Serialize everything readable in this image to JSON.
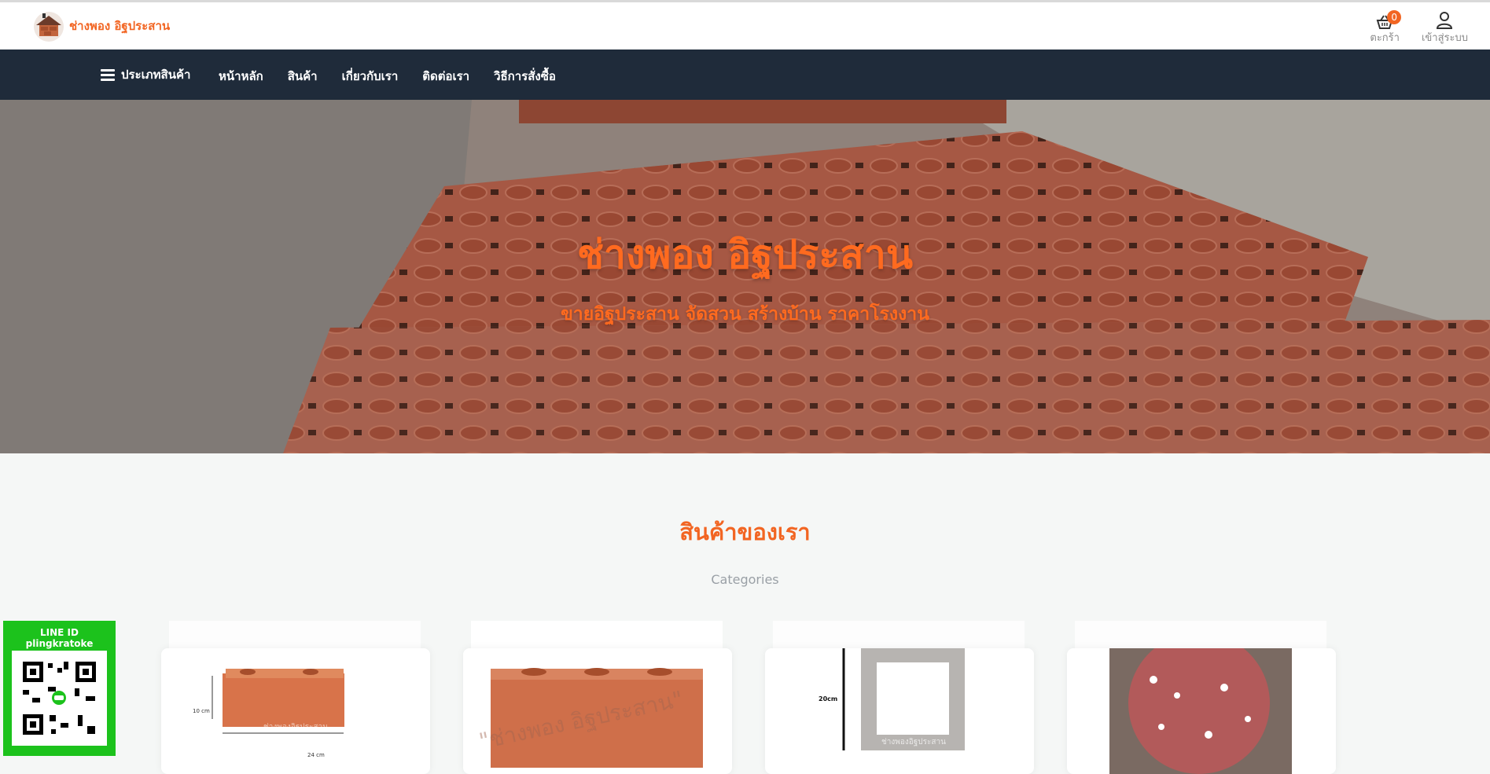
{
  "header": {
    "logo_text": "ช่างพอง อิฐประสาน",
    "cart_label": "ตะกร้า",
    "cart_count": "0",
    "login_label": "เข้าสู่ระบบ"
  },
  "nav": {
    "categories_label": "ประเภทสินค้า",
    "links": [
      "หน้าหลัก",
      "สินค้า",
      "เกี่ยวกับเรา",
      "ติดต่อเรา",
      "วิธีการสั่งซื้อ"
    ]
  },
  "hero": {
    "title": "ช่างพอง อิฐประสาน",
    "subtitle": "ขายอิฐประสาน จัดสวน สร้างบ้าน ราคาโรงงาน"
  },
  "products_section": {
    "title": "สินค้าของเรา",
    "subtitle": "Categories"
  },
  "cards": [
    {
      "dim_h": "10 cm",
      "dim_w": "24 cm",
      "watermark": "ช่างพองอิฐประสาน"
    },
    {
      "watermark": "\"ช่างพอง อิฐประสาน\""
    },
    {
      "dim_h": "20cm",
      "watermark": "ช่างพองอิฐประสาน"
    },
    {}
  ],
  "line_widget": {
    "label": "LINE ID",
    "id": "plingkratoke"
  },
  "colors": {
    "brand": "#f26522",
    "navbar": "#1f2b3a",
    "line_green": "#1cc21c"
  }
}
